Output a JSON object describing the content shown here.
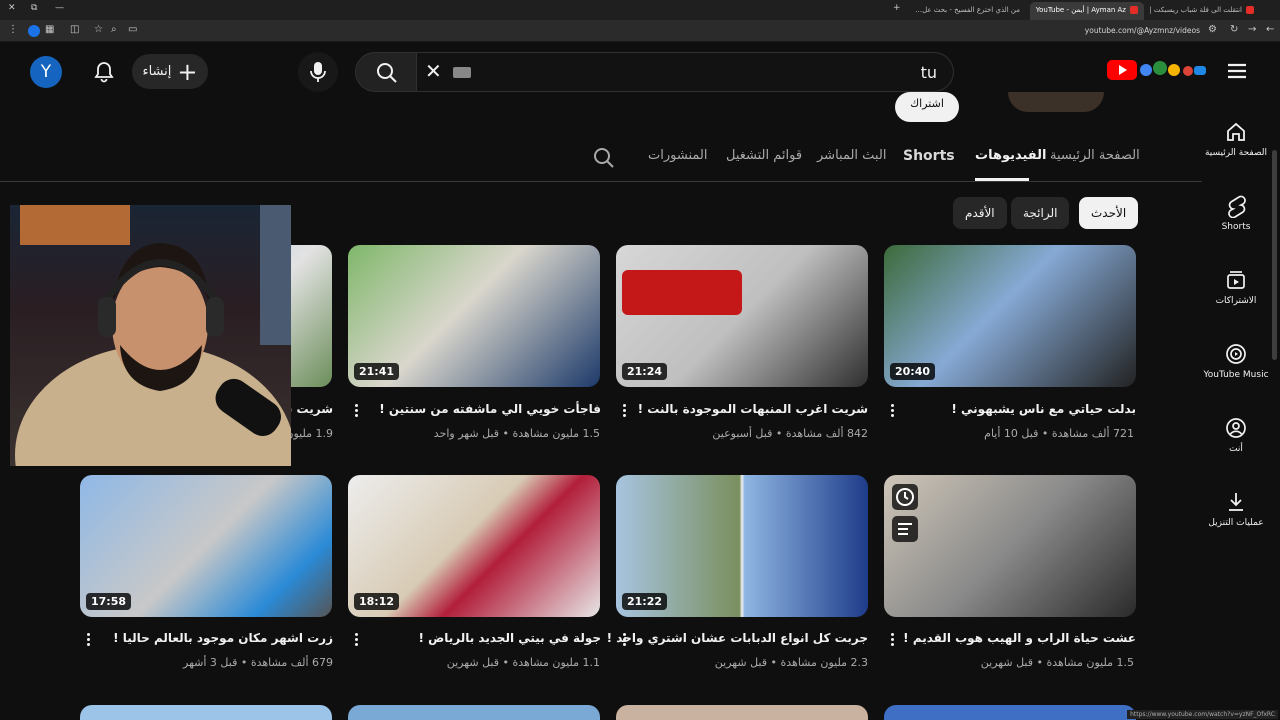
{
  "browser": {
    "tabs": [
      {
        "title": "من الذي اخترع الفسيخ - بحث عل…",
        "active": false
      },
      {
        "title": "Ayman Az | أيمن - YouTube",
        "active": true
      },
      {
        "title": "انتقلت الى فلة شباب ريسبكت | …",
        "active": false
      }
    ],
    "url": "youtube.com/@Ayzmnz/videos",
    "status_url": "https://www.youtube.com/watch?v=yzNF_OfxRC"
  },
  "masthead": {
    "avatar_letter": "Y",
    "create_label": "إنشاء",
    "search_value": "tu",
    "menu_icon": "hamburger-icon"
  },
  "channel": {
    "subscribe_label": "اشتراك",
    "tabs": [
      "الصفحة الرئيسية",
      "الفيديوهات",
      "Shorts",
      "البث المباشر",
      "قوائم التشغيل",
      "المنشورات"
    ],
    "active_tab": "الفيديوهات"
  },
  "chips": {
    "latest": "الأحدث",
    "popular": "الرائجة",
    "oldest": "الأقدم"
  },
  "videos": [
    {
      "title": "بدلت حياتي مع ناس يشبهوني !",
      "views": "721 ألف مشاهدة",
      "age": "قبل 10 أيام",
      "duration": "20:40"
    },
    {
      "title": "شريت اغرب المنبهات الموجودة بالنت !",
      "views": "842 ألف مشاهدة",
      "age": "قبل أسبوعين",
      "duration": "21:24"
    },
    {
      "title": "فاجأت خويي الي ماشفته من سنتين !",
      "views": "1.5 مليون مشاهدة",
      "age": "قبل شهر واحد",
      "duration": "21:41"
    },
    {
      "title": "شريت سي…",
      "views": "1.9 مليون…",
      "age": "",
      "duration": ""
    },
    {
      "title": "عشت حياة الراب و الهيب هوب القديم !",
      "views": "1.5 مليون مشاهدة",
      "age": "قبل شهرين",
      "duration": ""
    },
    {
      "title": "جربت كل انواع الدبابات عشان اشتري واحد !",
      "views": "2.3 مليون مشاهدة",
      "age": "قبل شهرين",
      "duration": "21:22"
    },
    {
      "title": "جولة في بيتي الجديد بالرياض !",
      "views": "1.1 مليون مشاهدة",
      "age": "قبل شهرين",
      "duration": "18:12"
    },
    {
      "title": "زرت اشهر مكان موجود بالعالم حاليا !",
      "views": "679 ألف مشاهدة",
      "age": "قبل 3 أشهر",
      "duration": "17:58"
    }
  ],
  "guide": {
    "home": "الصفحة الرئيسية",
    "shorts": "Shorts",
    "subscriptions": "الاشتراكات",
    "music": "YouTube Music",
    "you": "أنت",
    "downloads": "عمليات التنزيل"
  },
  "colors": {
    "background": "#0f0f0f",
    "brand": "#ff0000",
    "avatar": "#1565c0"
  }
}
